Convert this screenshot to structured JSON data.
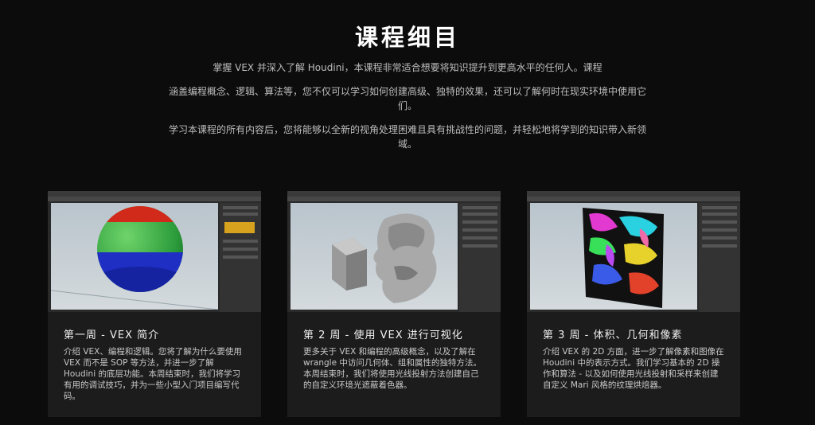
{
  "page": {
    "title": "课程细目",
    "intro": [
      "掌握 VEX 并深入了解 Houdini，本课程非常适合想要将知识提升到更高水平的任何人。课程",
      "涵盖编程概念、逻辑、算法等，您不仅可以学习如何创建高级、独特的效果，还可以了解何时在现实环境中使用它们。",
      "学习本课程的所有内容后，您将能够以全新的视角处理困难且具有挑战性的问题，并轻松地将学到的知识带入新领域。"
    ]
  },
  "cards": [
    {
      "heading": "第一周 - VEX 简介",
      "description": "介绍 VEX、编程和逻辑。您将了解为什么要使用 VEX 而不是 SOP 等方法，并进一步了解 Houdini 的底层功能。本周结束时，我们将学习有用的调试技巧，并为一些小型入门项目编写代码。",
      "image": "houdini-sphere-viewport"
    },
    {
      "heading": "第 2 周 - 使用 VEX 进行可视化",
      "description": "更多关于 VEX 和编程的高级概念，以及了解在 wrangle 中访问几何体、组和属性的独特方法。本周结束时，我们将使用光线投射方法创建自己的自定义环境光遮蔽着色器。",
      "image": "houdini-bust-viewport"
    },
    {
      "heading": "第 3 周 - 体积、几何和像素",
      "description": "介绍 VEX 的 2D 方面，进一步了解像素和图像在 Houdini 中的表示方式。我们学习基本的 2D 操作和算法 - 以及如何使用光线投射和采样来创建自定义 Mari 风格的纹理烘焙器。",
      "image": "houdini-texture-viewport"
    }
  ]
}
